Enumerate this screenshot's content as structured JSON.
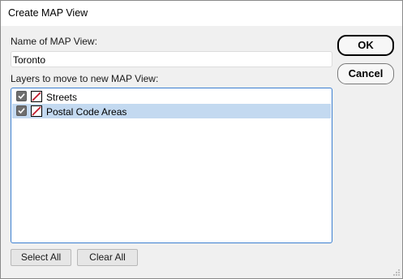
{
  "window": {
    "title": "Create MAP View"
  },
  "form": {
    "name_label": "Name of MAP View:",
    "name_value": "Toronto",
    "layers_label": "Layers to move to new MAP View:"
  },
  "layers": [
    {
      "name": "Streets",
      "checked": true,
      "selected": false,
      "icon": "layer-style-icon"
    },
    {
      "name": "Postal Code Areas",
      "checked": true,
      "selected": true,
      "icon": "layer-style-icon"
    }
  ],
  "buttons": {
    "ok": "OK",
    "cancel": "Cancel",
    "select_all": "Select All",
    "clear_all": "Clear All"
  },
  "colors": {
    "selection": "#c3d9f0",
    "list_border": "#3c7fd1",
    "layer_icon_slash": "#c0182a",
    "checkbox_fill": "#6e6e6e"
  }
}
